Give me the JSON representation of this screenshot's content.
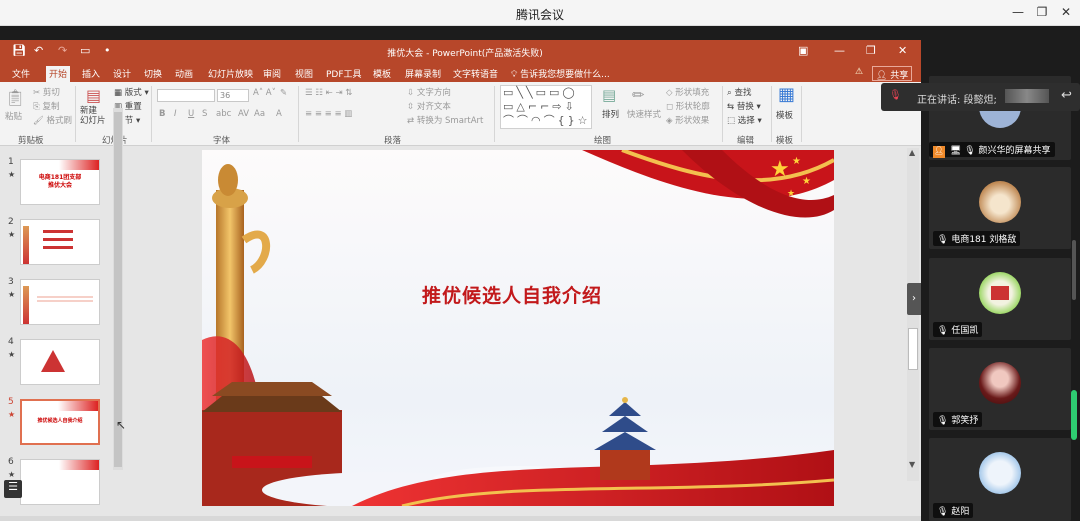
{
  "app_title": "腾讯会议",
  "ppt": {
    "window_title": "推优大会 - PowerPoint(产品激活失败)",
    "menu": [
      "文件",
      "开始",
      "插入",
      "设计",
      "切换",
      "动画",
      "幻灯片放映",
      "审阅",
      "视图",
      "PDF工具",
      "模板",
      "屏幕录制",
      "文字转语音"
    ],
    "tell_me": "告诉我您想要做什么...",
    "share": "共享",
    "ribbon": {
      "paste": "粘贴",
      "cut": "剪切",
      "copy": "复制",
      "format_painter": "格式刷",
      "clipboard": "剪贴板",
      "new_slide": "新建\n幻灯片",
      "layout": "版式",
      "reset": "重置",
      "section": "节",
      "slides": "幻灯片",
      "font_size": "36",
      "font": "字体",
      "text_direction": "文字方向",
      "align_text": "对齐文本",
      "smartart": "转换为 SmartArt",
      "paragraph": "段落",
      "arrange": "排列",
      "quick_styles": "快速样式",
      "shape_fill": "形状填充",
      "shape_outline": "形状轮廓",
      "shape_effects": "形状效果",
      "drawing": "绘图",
      "find": "查找",
      "replace": "替换",
      "select": "选择",
      "editing": "编辑",
      "template": "模板",
      "template_group": "模板"
    },
    "thumbnails": [
      {
        "num": "1",
        "title": "电商181团支部\n推优大会"
      },
      {
        "num": "2",
        "title": ""
      },
      {
        "num": "3",
        "title": ""
      },
      {
        "num": "4",
        "title": ""
      },
      {
        "num": "5",
        "title": "推优候选人自我介绍"
      },
      {
        "num": "6",
        "title": ""
      }
    ],
    "slide": {
      "title": "推优候选人自我介绍"
    }
  },
  "meeting": {
    "speaking": "正在讲话: 段懿炟;",
    "participants": [
      {
        "name": "颜兴华的屏幕共享"
      },
      {
        "name": "电商181 刘格敌"
      },
      {
        "name": "任国凯"
      },
      {
        "name": "郭笑抒"
      },
      {
        "name": "赵阳"
      }
    ]
  },
  "colors": {
    "ppt_accent": "#b7472a",
    "slide_title": "#c2191b",
    "dark_panel": "#1c1c1c"
  }
}
